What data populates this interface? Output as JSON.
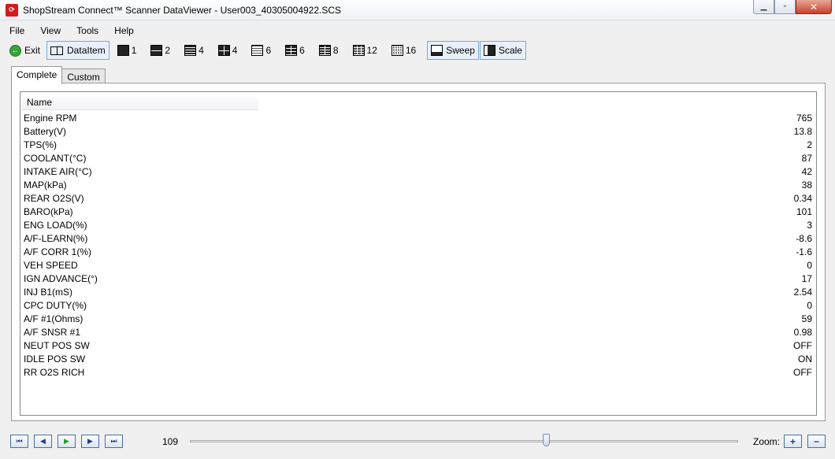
{
  "window": {
    "title": "ShopStream Connect™ Scanner DataViewer - User003_40305004922.SCS",
    "minimize": "▁",
    "maximize": "▫",
    "close": "✕"
  },
  "menu": [
    "File",
    "View",
    "Tools",
    "Help"
  ],
  "toolbar": {
    "exit_label": "Exit",
    "dataitem_label": "DataItem",
    "layouts": [
      "1",
      "2",
      "4",
      "4",
      "6",
      "6",
      "8",
      "12",
      "16"
    ],
    "sweep_label": "Sweep",
    "scale_label": "Scale"
  },
  "tabs": [
    "Complete",
    "Custom"
  ],
  "list": {
    "header": "Name",
    "rows": [
      {
        "name": "Engine RPM",
        "value": "765"
      },
      {
        "name": "Battery(V)",
        "value": "13.8"
      },
      {
        "name": "TPS(%)",
        "value": "2"
      },
      {
        "name": "COOLANT(°C)",
        "value": "87"
      },
      {
        "name": "INTAKE AIR(°C)",
        "value": "42"
      },
      {
        "name": "MAP(kPa)",
        "value": "38"
      },
      {
        "name": "REAR O2S(V)",
        "value": "0.34"
      },
      {
        "name": "BARO(kPa)",
        "value": "101"
      },
      {
        "name": "ENG LOAD(%)",
        "value": "3"
      },
      {
        "name": "A/F-LEARN(%)",
        "value": "-8.6"
      },
      {
        "name": "A/F CORR 1(%)",
        "value": "-1.6"
      },
      {
        "name": "VEH SPEED",
        "value": "0"
      },
      {
        "name": "IGN ADVANCE(°)",
        "value": "17"
      },
      {
        "name": "INJ B1(mS)",
        "value": "2.54"
      },
      {
        "name": "CPC DUTY(%)",
        "value": "0"
      },
      {
        "name": "A/F #1(Ohms)",
        "value": "59"
      },
      {
        "name": "A/F SNSR #1",
        "value": "0.98"
      },
      {
        "name": "NEUT POS SW",
        "value": "OFF"
      },
      {
        "name": "IDLE POS SW",
        "value": "ON"
      },
      {
        "name": "RR O2S RICH",
        "value": "OFF"
      }
    ]
  },
  "playback": {
    "frame": "109",
    "position_fraction": 0.65,
    "zoom_label": "Zoom:",
    "zoom_in": "+",
    "zoom_out": "−",
    "first": "⏮",
    "prev": "◀",
    "play": "▶",
    "next": "▶",
    "last": "⏭"
  }
}
